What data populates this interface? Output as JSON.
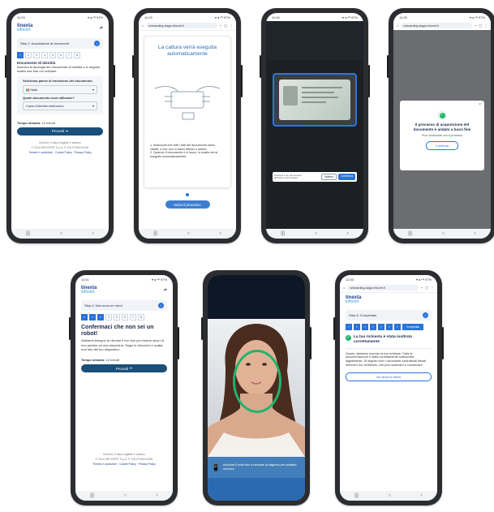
{
  "phone1": {
    "status_time": "11:03",
    "status_right": "▾ ◂ ⁴ᴳ 97%",
    "brand_line1": "tinexta",
    "brand_line2": "infocert",
    "step": "Step 2: Acquisizione di documenti",
    "steps": [
      "✓",
      "2",
      "3",
      "4",
      "5",
      "6",
      "7",
      "8"
    ],
    "section_title": "Documento di identità",
    "section_text": "Inserisci la tipologia del documento di identità e in seguito scatta una foto col cellulare",
    "country_label": "Seleziona paese di emissione del documento",
    "country_value": "Italia",
    "doc_label": "Quale documento vuoi utilizzare?",
    "doc_value": "Carta d'identità elettronica",
    "time_label": "Tempo stimato:",
    "time_value": "12 minuti",
    "proceed": "Procedi",
    "footer_tag": "InfoCert, il futuro digitale è adesso",
    "footer_small": "© 2024 INFOCERT S.p.A. P. IVA 07945211006",
    "terms": "Termini e condizioni",
    "cookie": "Cookie Policy",
    "privacy": "Privacy Policy"
  },
  "phone2": {
    "status_time": "11:03",
    "status_right": "▾ ◂ ⁴ᴳ 97%",
    "url": "onboarding-stage.infocert.it",
    "title": "La cattura verrà eseguita automaticamente",
    "instr1": "1. Assicurati che tutti i dati del documento siano visibili, e che non ci siano riflessi o ombre.",
    "instr2": "2. Quando il documento è a fuoco, lo scatto verrà eseguito automaticamente",
    "start": "Inizia il processo"
  },
  "phone3": {
    "status_time": "11:04",
    "status_right": "▾ ◂ ⁴ᴳ 97%",
    "hint": "Inserisci il tuo documento all'interno del riquadro",
    "btn_left": "Indietro",
    "btn_right": "Conferma"
  },
  "phone4": {
    "status_time": "11:05",
    "status_right": "▾ ◂ ⁴ᴳ 97%",
    "url": "onboarding-stage.infocert.it",
    "msg": "Il processo di acquisizione del documento è andato a buon fine",
    "sub": "Puoi continuare con il processo",
    "continue": "Continua"
  },
  "phone5": {
    "status_time": "11:01",
    "status_right": "▾ ◂ ⁴ᴳ 97%",
    "brand_line1": "tinexta",
    "brand_line2": "infocert",
    "step": "Step 4: Non sono un robot",
    "steps": [
      "✓",
      "✓",
      "✓",
      "4",
      "5",
      "6",
      "7",
      "8"
    ],
    "heading": "Confermaci che non sei un robot!",
    "body": "Abbiamo bisogno di rilevare il tuo viso per essere sicuri di non parlare ad una macchina. Segui le istruzioni e scatta una foto del tuo dispositivo.",
    "time_label": "Tempo stimato:",
    "time_value": "12 minuti",
    "proceed": "Procedi",
    "footer_tag": "InfoCert, il futuro digitale è adesso",
    "footer_small": "© 2024 INFOCERT S.p.A. P. IVA 07945211006",
    "terms": "Termini e condizioni",
    "cookie": "Cookie Policy",
    "privacy": "Privacy Policy"
  },
  "phone6": {
    "caption": "Avvicina il volto fino a riempire la sagoma per scattare una foto"
  },
  "phone7": {
    "status_time": "12:53",
    "status_right": "▾ ◂ ⁴ᴳ 97%",
    "url": "onboarding-stage.infocert.it",
    "brand_line1": "tinexta",
    "brand_line2": "infocert",
    "step": "Step 8: Completato",
    "steps": [
      "✓",
      "✓",
      "✓",
      "✓",
      "✓",
      "✓",
      "✓"
    ],
    "steps_done": "Completato",
    "title": "La tua richiesta è stata inoltrata correttamente",
    "body": "Grazie, abbiamo ricevuto la tua richiesta. Tutta la documentazione è stata correttamente sottoscritta digitalmente. Di seguito trovi i documenti contrattuali firmati inerenti il tuo certificato, che puoi scaricare e conservare.",
    "back": "Vai all'area clienti"
  },
  "colors": {
    "brand_navy": "#1e3f8f",
    "brand_blue": "#2a9bd6",
    "button": "#1a4f7a",
    "success": "#1fb46a"
  }
}
